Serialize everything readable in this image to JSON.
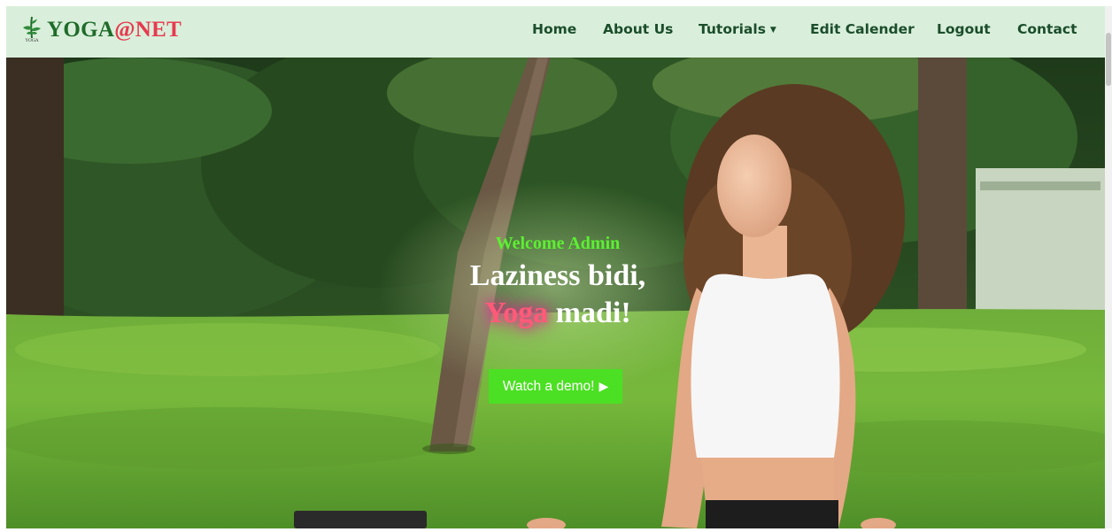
{
  "brand": {
    "name_part1": "YOGA",
    "name_at": "@",
    "name_part2": "NET",
    "logo_caption": "YOGA",
    "logo_icon": "yoga-plant-icon"
  },
  "nav": {
    "home": "Home",
    "about": "About Us",
    "tutorials": "Tutorials",
    "edit_calendar": "Edit Calender",
    "logout": "Logout",
    "contact": "Contact",
    "dropdown_icon": "caret-down-icon"
  },
  "hero": {
    "greeting": "Welcome Admin",
    "tagline_line1": "Laziness bidi,",
    "tagline_highlight": "Yoga",
    "tagline_rest": " madi!",
    "cta_label": "Watch a demo!",
    "cta_icon": "play-icon",
    "background_description": "woman-meditating-in-park-photo"
  },
  "colors": {
    "navbar_bg": "#d9efdb",
    "brand_green": "#1f6b2a",
    "brand_red": "#e63a4f",
    "greeting_green": "#5cf032",
    "cta_green": "#4be023",
    "highlight_pink": "#ff5a78"
  }
}
